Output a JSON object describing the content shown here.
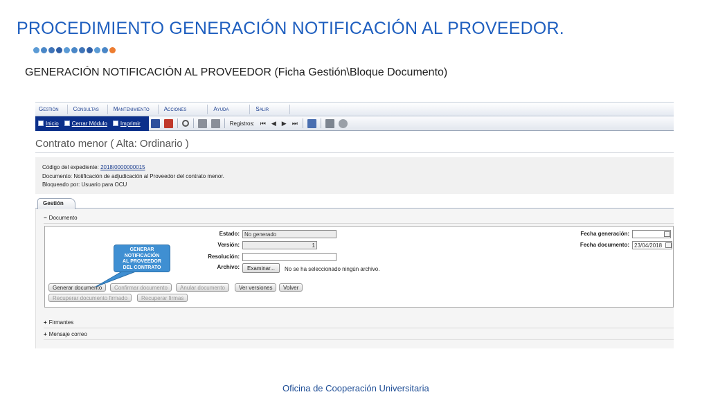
{
  "slide": {
    "title": "PROCEDIMIENTO GENERACIÓN NOTIFICACIÓN AL PROVEEDOR.",
    "subtitle": "GENERACIÓN NOTIFICACIÓN AL PROVEEDOR (Ficha Gestión\\Bloque Documento)",
    "footer": "Oficina de Cooperación Universitaria",
    "dot_colors": [
      "#5b9bd5",
      "#4a87c7",
      "#3f74b8",
      "#2f5fa7",
      "#5b9bd5",
      "#4a87c7",
      "#3f74b8",
      "#2f5fa7",
      "#5b9bd5",
      "#4a87c7",
      "#ed7d31"
    ]
  },
  "menu": [
    "Gestión",
    "Consultas",
    "Mantenimiento",
    "Acciones",
    "Ayuda",
    "Salir"
  ],
  "toolbar": {
    "inicio": "Inicio",
    "cerrar_modulo": "Cerrar Módulo",
    "imprimir": "Imprimir",
    "registros": "Registros:",
    "icons": [
      "save-icon",
      "delete-icon",
      "search-icon",
      "first-icon",
      "prev-icon",
      "next-icon",
      "last-icon",
      "window-icon",
      "settings-icon"
    ]
  },
  "app_title": "Contrato menor ( Alta: Ordinario )",
  "info": {
    "expediente_label": "Código del expediente:",
    "expediente_value": "2018/0000000015",
    "documento_line": "Documento: Notificación de adjudicación al Proveedor del contrato menor.",
    "bloqueado_line": "Bloqueado por: Usuario para OCU"
  },
  "tab": "Gestión",
  "sections": {
    "documento": {
      "sign": "−",
      "label": "Documento"
    },
    "firmantes": {
      "sign": "+",
      "label": "Firmantes"
    },
    "mensaje": {
      "sign": "+",
      "label": "Mensaje correo"
    }
  },
  "form": {
    "estado_label": "Estado:",
    "estado_value": "No generado",
    "version_label": "Versión:",
    "version_value": "1",
    "resolucion_label": "Resolución:",
    "resolucion_value": "",
    "archivo_label": "Archivo:",
    "examinar": "Examinar...",
    "no_file": "No se ha seleccionado ningún archivo.",
    "fecha_generacion_label": "Fecha generación:",
    "fecha_generacion_value": "",
    "fecha_documento_label": "Fecha documento:",
    "fecha_documento_value": "23/04/2018"
  },
  "buttons": {
    "generar": "Generar documento",
    "confirmar": "Confirmar documento",
    "anular": "Anular documento",
    "ver_versiones": "Ver versiones",
    "volver": "Volver",
    "recuperar_firmado": "Recuperar documento firmado",
    "recuperar_firmas": "Recuperar firmas"
  },
  "callout": {
    "line1": "GENERAR",
    "line2": "NOTIFICACIÓN",
    "line3": "AL PROVEEDOR",
    "line4": "DEL CONTRATO",
    "color": "#3f8fd2"
  }
}
